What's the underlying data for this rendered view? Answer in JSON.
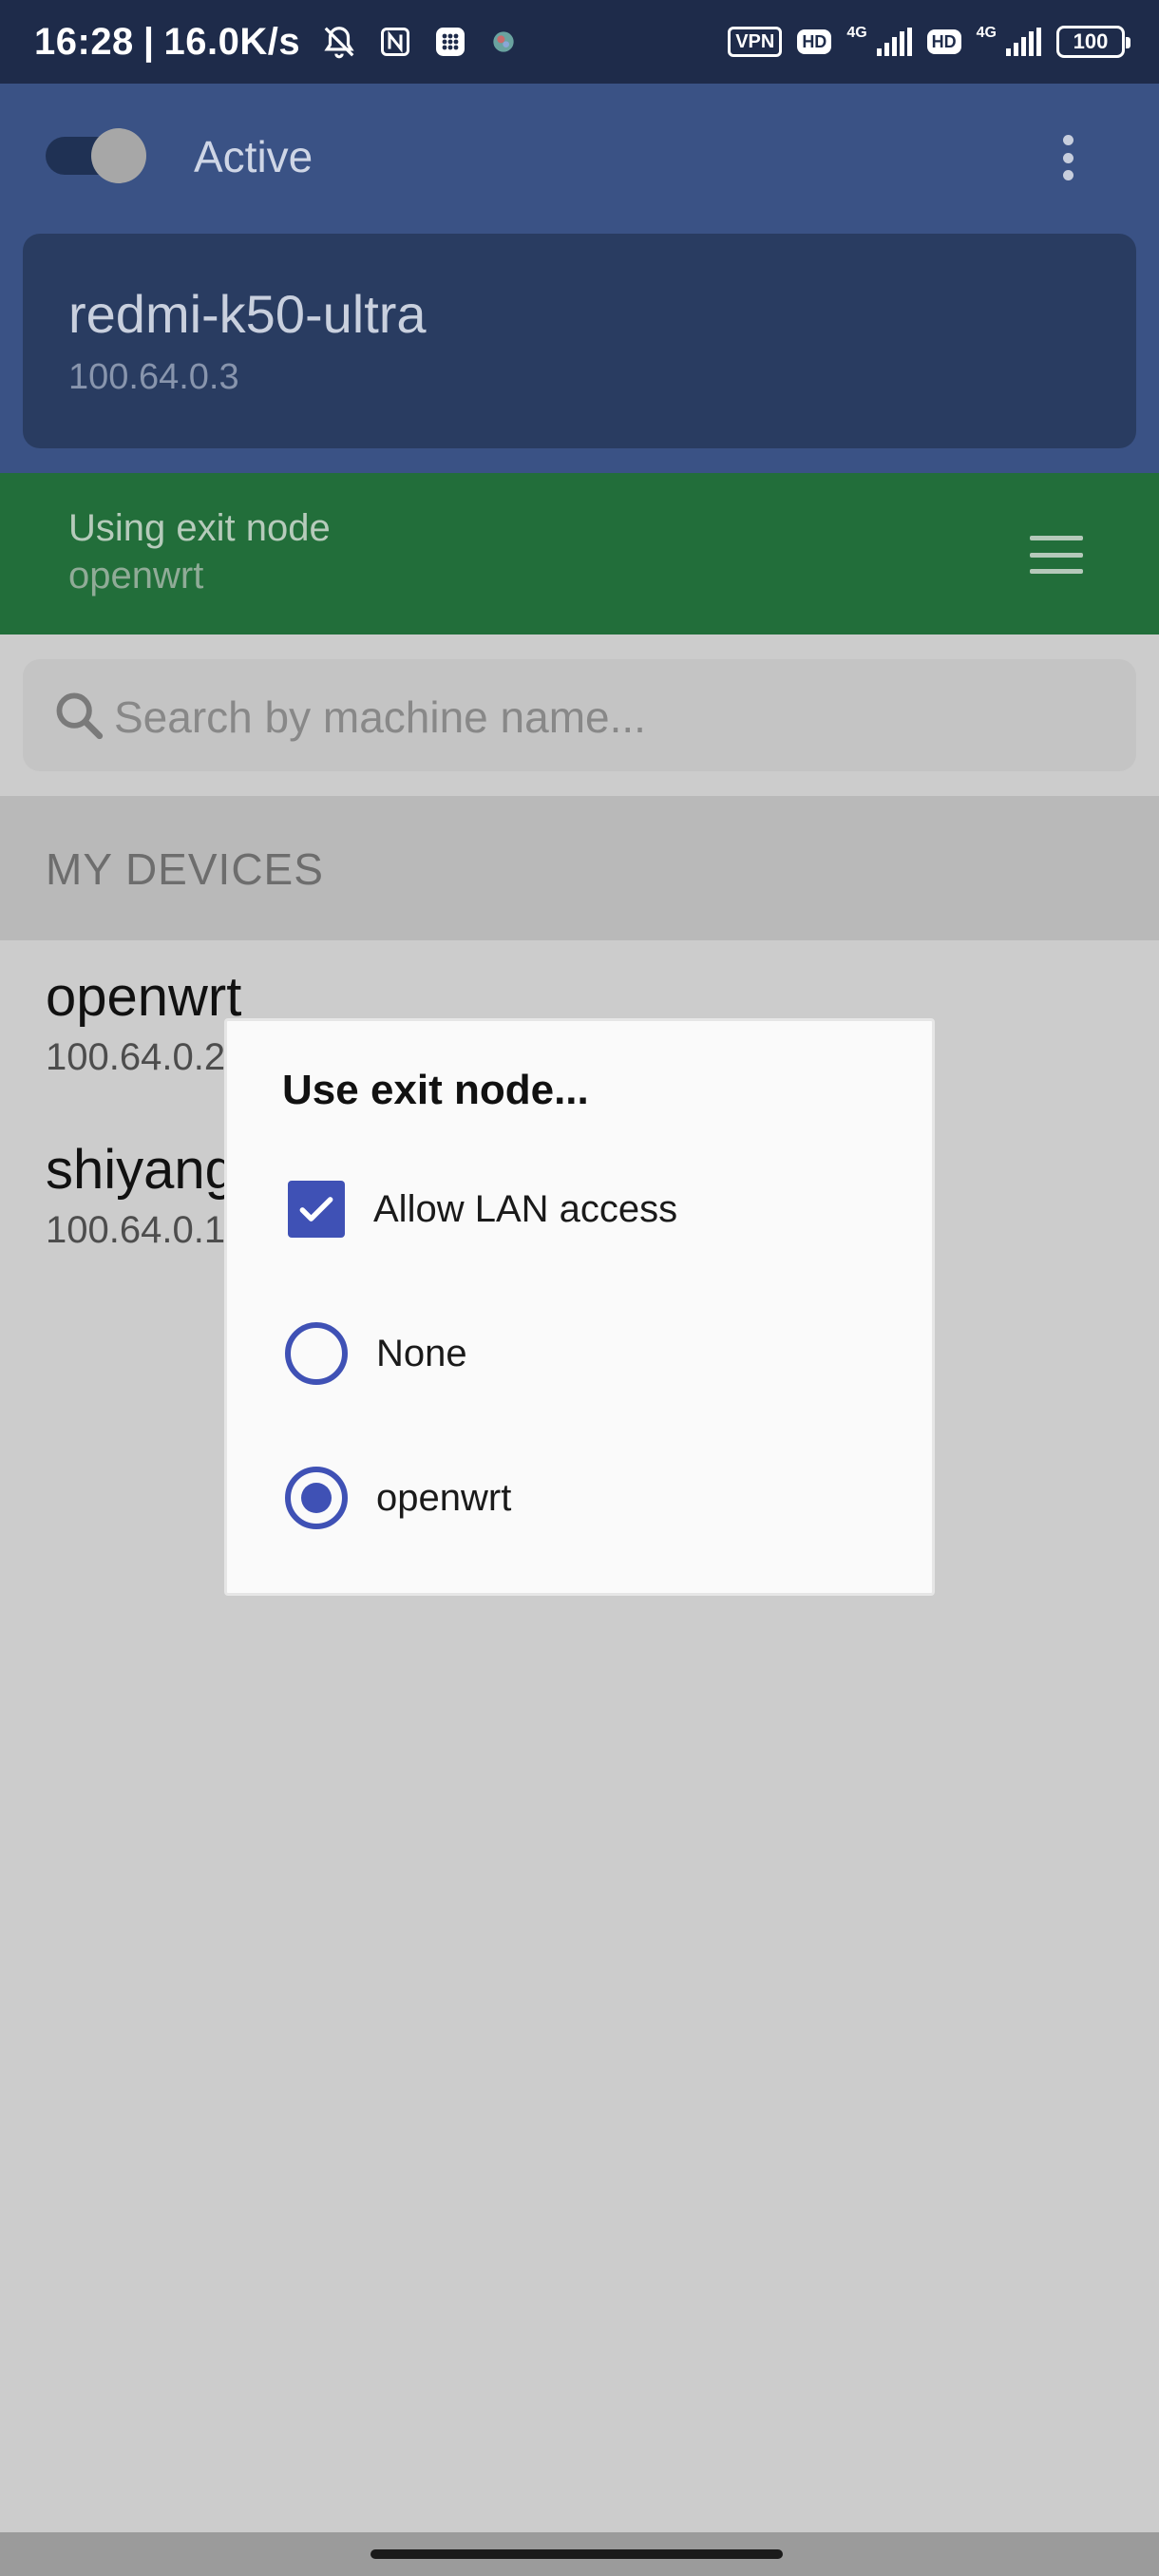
{
  "status_bar": {
    "time": "16:28",
    "separator": "|",
    "net_speed": "16.0K/s",
    "vpn": "VPN",
    "hd1": "HD",
    "hd2": "HD",
    "network1": "4G",
    "network2": "4G",
    "battery": "100"
  },
  "header": {
    "toggle_state": "on",
    "active_label": "Active",
    "device_name": "redmi-k50-ultra",
    "device_ip": "100.64.0.3"
  },
  "exit_banner": {
    "title": "Using exit node",
    "node": "openwrt"
  },
  "search": {
    "placeholder": "Search by machine name..."
  },
  "devices_section": {
    "title": "MY DEVICES",
    "items": [
      {
        "name": "openwrt",
        "ip": "100.64.0.2"
      },
      {
        "name": "shiyang",
        "ip": "100.64.0.1"
      }
    ]
  },
  "dialog": {
    "title": "Use exit node...",
    "allow_lan": {
      "label": "Allow LAN access",
      "checked": true
    },
    "options": [
      {
        "label": "None",
        "selected": false
      },
      {
        "label": "openwrt",
        "selected": true
      }
    ]
  },
  "colors": {
    "status_bar": "#1e2b4a",
    "header": "#3a5285",
    "exit_banner": "#226e3a",
    "accent": "#3f51b5",
    "scrim": "#cccccc"
  }
}
